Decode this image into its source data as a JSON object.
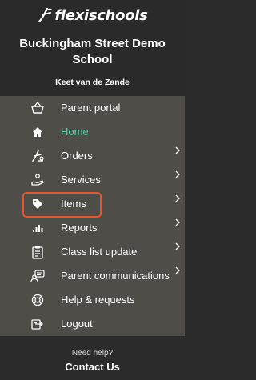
{
  "brand": {
    "name": "flexischools",
    "icon": "flexischools-logo-mark"
  },
  "school": {
    "name": "Buckingham Street Demo School"
  },
  "user": {
    "name": "Keet van de Zande"
  },
  "menu": {
    "items": [
      {
        "label": "Parent portal",
        "icon": "basket-icon",
        "has_submenu": false
      },
      {
        "label": "Home",
        "icon": "home-icon",
        "has_submenu": false,
        "active": true
      },
      {
        "label": "Orders",
        "icon": "orders-icon",
        "has_submenu": true
      },
      {
        "label": "Services",
        "icon": "services-icon",
        "has_submenu": true
      },
      {
        "label": "Items",
        "icon": "tag-icon",
        "has_submenu": true,
        "highlighted": true
      },
      {
        "label": "Reports",
        "icon": "bar-chart-icon",
        "has_submenu": true
      },
      {
        "label": "Class list update",
        "icon": "clipboard-icon",
        "has_submenu": true
      },
      {
        "label": "Parent communications",
        "icon": "chat-icon",
        "has_submenu": true
      },
      {
        "label": "Help & requests",
        "icon": "lifebuoy-icon",
        "has_submenu": false
      },
      {
        "label": "Logout",
        "icon": "logout-icon",
        "has_submenu": false
      }
    ]
  },
  "footer": {
    "help_text": "Need help?",
    "contact_label": "Contact Us"
  },
  "colors": {
    "header_bg": "#2a2a2a",
    "menu_bg": "#4e4d48",
    "active": "#4fd0a6",
    "highlight": "#e8542c"
  }
}
